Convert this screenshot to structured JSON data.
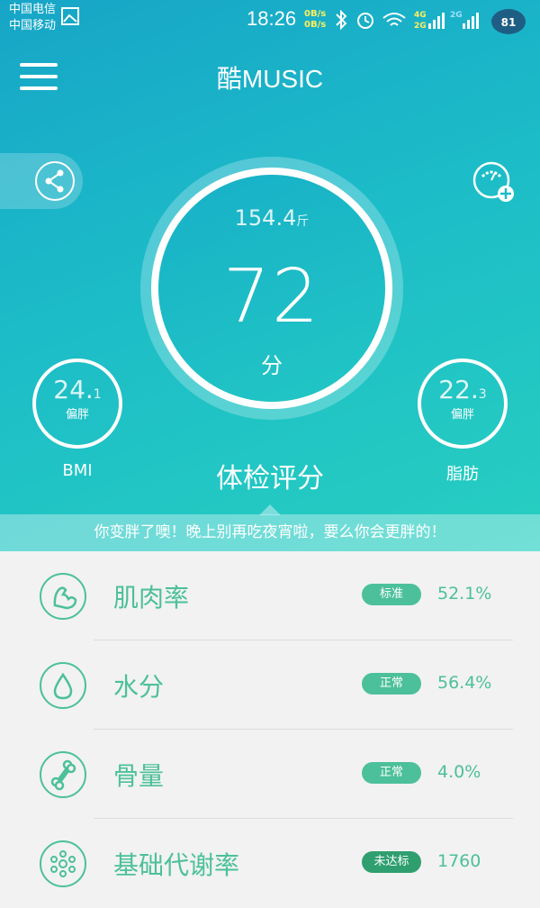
{
  "status_bar": {
    "carrier1": "中国电信",
    "carrier2": "中国移动",
    "time": "18:26",
    "rate1": "0B/s",
    "rate2": "0B/s",
    "battery": "81"
  },
  "header": {
    "title": "酷MUSIC"
  },
  "main": {
    "weight_value": "154.4",
    "weight_unit": "斤",
    "score": "72",
    "score_unit": "分",
    "section_title": "体检评分",
    "tip": "你变胖了噢！晚上别再吃夜宵啦，要么你会更胖的！"
  },
  "bmi": {
    "value": "24.",
    "decimal": "1",
    "status": "偏胖",
    "label": "BMI"
  },
  "fat": {
    "value": "22.",
    "decimal": "3",
    "status": "偏胖",
    "label": "脂肪"
  },
  "list": [
    {
      "name": "肌肉率",
      "badge": "标准",
      "value": "52.1%",
      "icon": "muscle-icon"
    },
    {
      "name": "水分",
      "badge": "正常",
      "value": "56.4%",
      "icon": "water-drop-icon"
    },
    {
      "name": "骨量",
      "badge": "正常",
      "value": "4.0%",
      "icon": "bone-icon"
    },
    {
      "name": "基础代谢率",
      "badge": "未达标",
      "value": "1760",
      "icon": "metabolism-icon"
    }
  ],
  "colors": {
    "accent": "#4cc09a",
    "gradient_start": "#17a5c7",
    "gradient_end": "#27cfc0"
  }
}
